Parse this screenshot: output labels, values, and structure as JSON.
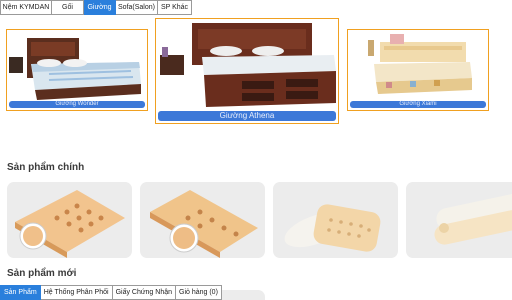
{
  "top_tabs": [
    {
      "label": "Nệm KYMDAN",
      "active": false
    },
    {
      "label": "Gối",
      "active": false
    },
    {
      "label": "Giường",
      "active": true
    },
    {
      "label": "Sofa(Salon)",
      "active": false
    },
    {
      "label": "SP Khác",
      "active": false
    }
  ],
  "carousel": [
    {
      "caption": "Giường Wonder"
    },
    {
      "caption": "Giường Athena"
    },
    {
      "caption": "Giường Xiami"
    }
  ],
  "sections": {
    "main_products": "Sản phẩm chính",
    "new_products": "Sản phẩm mới"
  },
  "bottom_tabs": [
    {
      "label": "Sản Phẩm",
      "active": true
    },
    {
      "label": "Hệ Thống Phân Phối",
      "active": false
    },
    {
      "label": "Giấy Chứng Nhận",
      "active": false
    },
    {
      "label": "Giỏ hàng (0)",
      "active": false
    }
  ],
  "colors": {
    "accent": "#2a7fdc",
    "card_border": "#f0a020",
    "caption_bg": "#3c78d8"
  }
}
